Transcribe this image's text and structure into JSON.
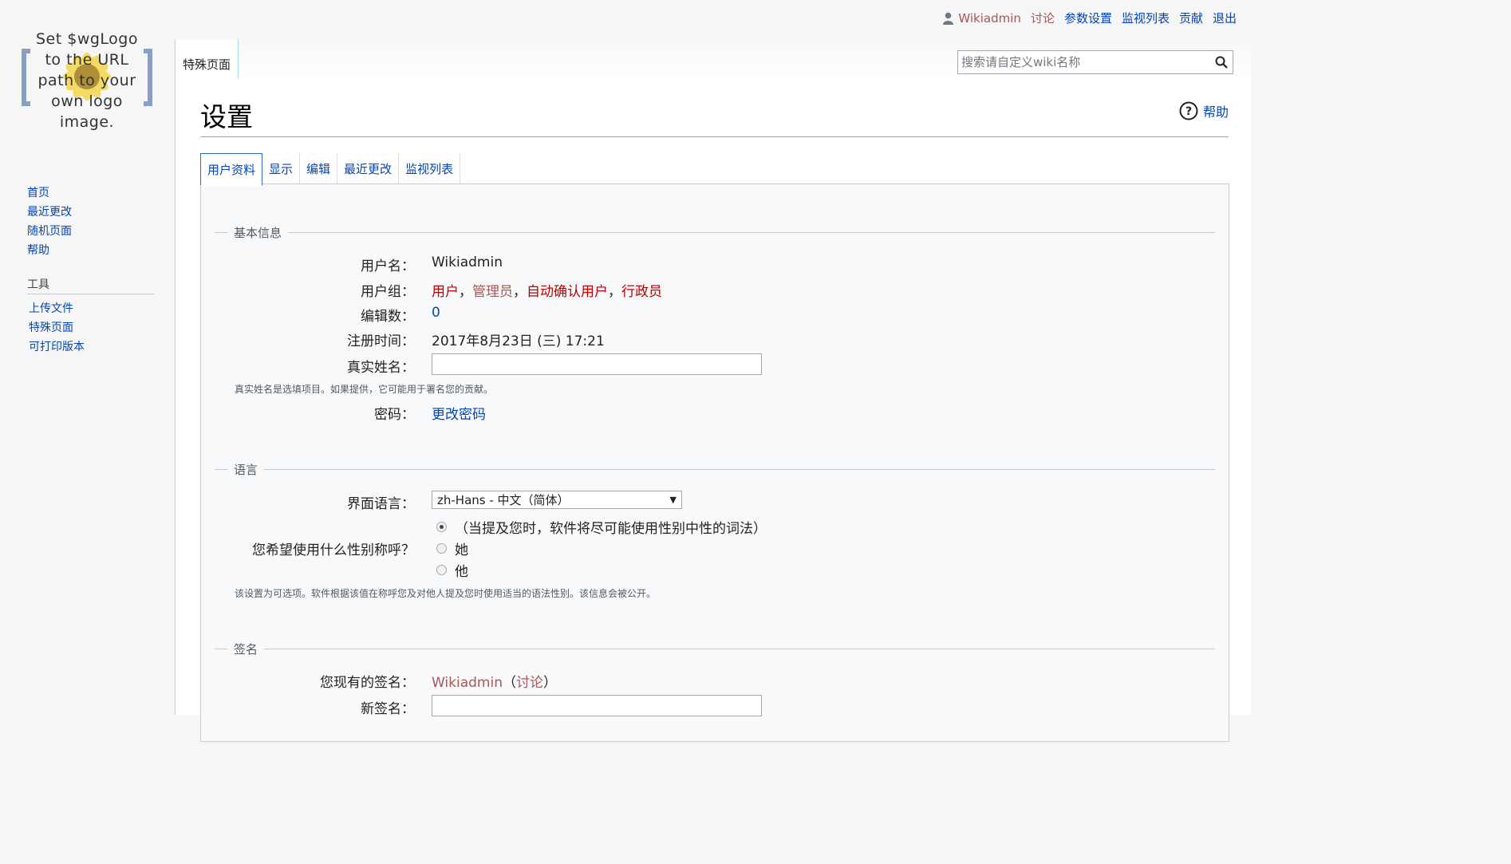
{
  "logo": {
    "lines": [
      "Set $wgLogo",
      "to the URL",
      "path to your",
      "own logo",
      "image."
    ]
  },
  "personal": {
    "username": "Wikiadmin",
    "talk": "讨论",
    "preferences": "参数设置",
    "watchlist": "监视列表",
    "contributions": "贡献",
    "logout": "退出"
  },
  "header": {
    "namespace_tab": "特殊页面",
    "search_placeholder": "搜索请自定义wiki名称"
  },
  "sidebar": {
    "nav": [
      "首页",
      "最近更改",
      "随机页面",
      "帮助"
    ],
    "tools_heading": "工具",
    "tools": [
      "上传文件",
      "特殊页面",
      "可打印版本"
    ]
  },
  "page": {
    "title": "设置",
    "help_label": "帮助",
    "tabs": [
      "用户资料",
      "显示",
      "编辑",
      "最近更改",
      "监视列表"
    ],
    "active_tab": "用户资料"
  },
  "basic_info": {
    "legend": "基本信息",
    "username_label": "用户名：",
    "username_value": "Wikiadmin",
    "groups_label": "用户组：",
    "groups": [
      "用户",
      "管理员",
      "自动确认用户",
      "行政员"
    ],
    "group_separator": "，",
    "edit_count_label": "编辑数：",
    "edit_count_value": "0",
    "registration_label": "注册时间：",
    "registration_value": "2017年8月23日 (三) 17:21",
    "realname_label": "真实姓名：",
    "realname_value": "",
    "realname_help": "真实姓名是选填项目。如果提供，它可能用于署名您的贡献。",
    "password_label": "密码：",
    "password_link": "更改密码"
  },
  "language": {
    "legend": "语言",
    "ui_language_label": "界面语言：",
    "ui_language_value": "zh-Hans - 中文（简体）",
    "gender_label": "您希望使用什么性别称呼？",
    "gender_options": [
      "（当提及您时，软件将尽可能使用性别中性的词法）",
      "她",
      "他"
    ],
    "gender_selected": 0,
    "gender_help": "该设置为可选项。软件根据该值在称呼您及对他人提及您时使用适当的语法性别。该信息会被公开。"
  },
  "signature": {
    "legend": "签名",
    "current_label": "您现有的签名：",
    "current_user": "Wikiadmin",
    "current_open": "（",
    "current_talk": "讨论",
    "current_close": "）",
    "new_label": "新签名：",
    "new_value": ""
  },
  "colors": {
    "link": "#0645ad",
    "redlink": "#ba0000",
    "visited": "#a55858",
    "border_blue": "#a7d7f9"
  }
}
